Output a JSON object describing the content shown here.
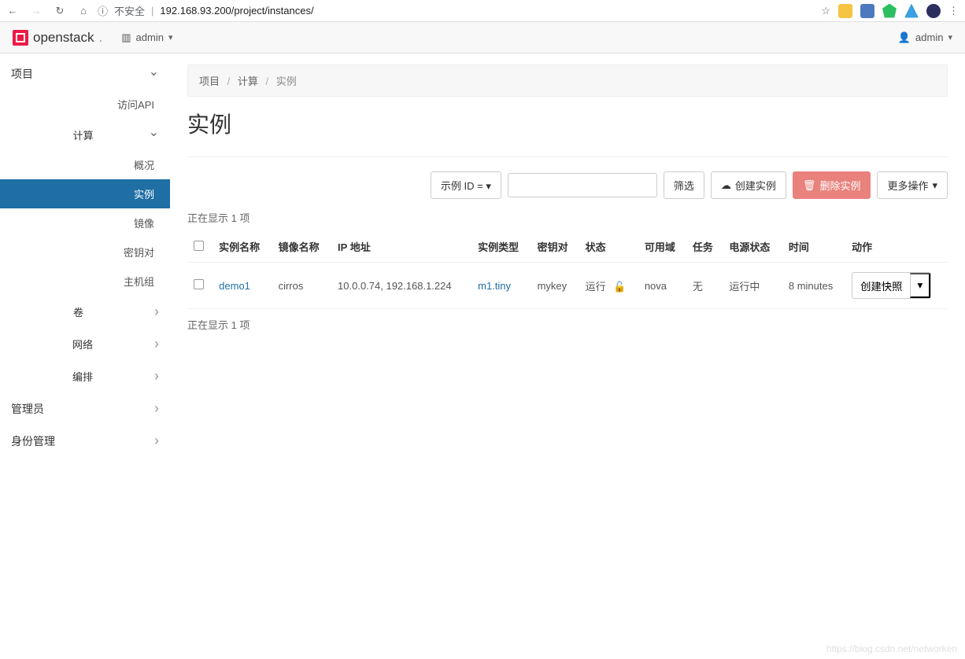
{
  "browser": {
    "insecure_label": "不安全",
    "url": "192.168.93.200/project/instances/"
  },
  "topbar": {
    "brand": "openstack",
    "project_label": "admin",
    "user_label": "admin"
  },
  "sidebar": {
    "project": "项目",
    "access_api": "访问API",
    "compute": "计算",
    "overview": "概况",
    "instances": "实例",
    "images": "镜像",
    "keypairs": "密钥对",
    "server_groups": "主机组",
    "volumes": "卷",
    "network": "网络",
    "orchestration": "编排",
    "admin": "管理员",
    "identity": "身份管理"
  },
  "breadcrumb": {
    "a": "项目",
    "b": "计算",
    "c": "实例"
  },
  "page": {
    "title": "实例"
  },
  "toolbar": {
    "filter_field": "示例 ID = ",
    "filter_btn": "筛选",
    "create_btn": "创建实例",
    "delete_btn": "删除实例",
    "more_btn": "更多操作"
  },
  "table": {
    "count_top": "正在显示 1 项",
    "count_bottom": "正在显示 1 项",
    "headers": {
      "name": "实例名称",
      "image": "镜像名称",
      "ip": "IP 地址",
      "flavor": "实例类型",
      "keypair": "密钥对",
      "status": "状态",
      "az": "可用域",
      "task": "任务",
      "power": "电源状态",
      "time": "时间",
      "actions": "动作"
    },
    "row": {
      "name": "demo1",
      "image": "cirros",
      "ip": "10.0.0.74, 192.168.1.224",
      "flavor": "m1.tiny",
      "keypair": "mykey",
      "status": "运行",
      "az": "nova",
      "task": "无",
      "power": "运行中",
      "time": "8 minutes",
      "action_main": "创建快照"
    }
  },
  "watermark": "https://blog.csdn.net/networken"
}
